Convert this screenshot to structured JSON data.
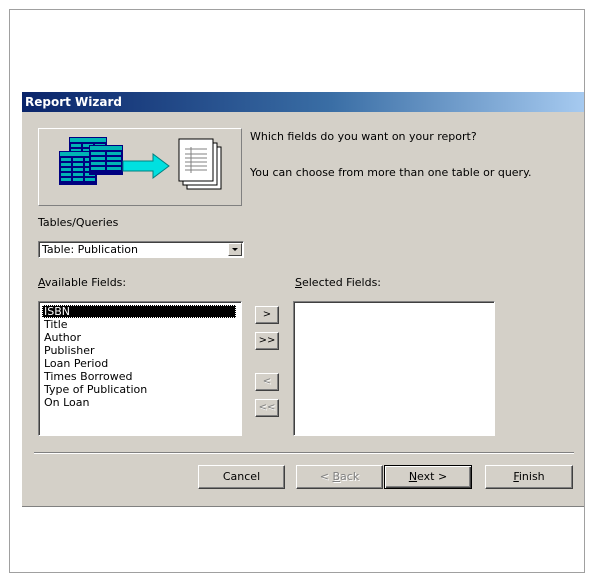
{
  "window": {
    "title": "Report Wizard"
  },
  "question": {
    "line1": "Which fields do you want on your report?",
    "line2": "You can choose from more than one table or query."
  },
  "tables_queries": {
    "label": "Tables/Queries",
    "selected": "Table: Publication"
  },
  "available_fields": {
    "label_prefix": "",
    "label_accel": "A",
    "label_rest": "vailable Fields:",
    "items": [
      "ISBN",
      "Title",
      "Author",
      "Publisher",
      "Loan Period",
      "Times Borrowed",
      "Type of Publication",
      "On Loan"
    ],
    "selected_index": 0
  },
  "selected_fields": {
    "label_accel": "S",
    "label_rest": "elected Fields:",
    "items": []
  },
  "move_buttons": {
    "add_one": ">",
    "add_all": ">>",
    "remove_one": "<",
    "remove_all": "<<"
  },
  "footer": {
    "cancel": "Cancel",
    "back_prefix": "< ",
    "back_accel": "B",
    "back_rest": "ack",
    "next_accel": "N",
    "next_rest": "ext >",
    "finish_accel": "F",
    "finish_rest": "inish"
  },
  "colors": {
    "title_start": "#0a246a",
    "title_end": "#a6caf0",
    "dialog_face": "#d4d0c8",
    "selection": "#000000"
  },
  "icons": {
    "illustration": "tables-to-report-illustration",
    "combo": "chevron-down-icon"
  }
}
